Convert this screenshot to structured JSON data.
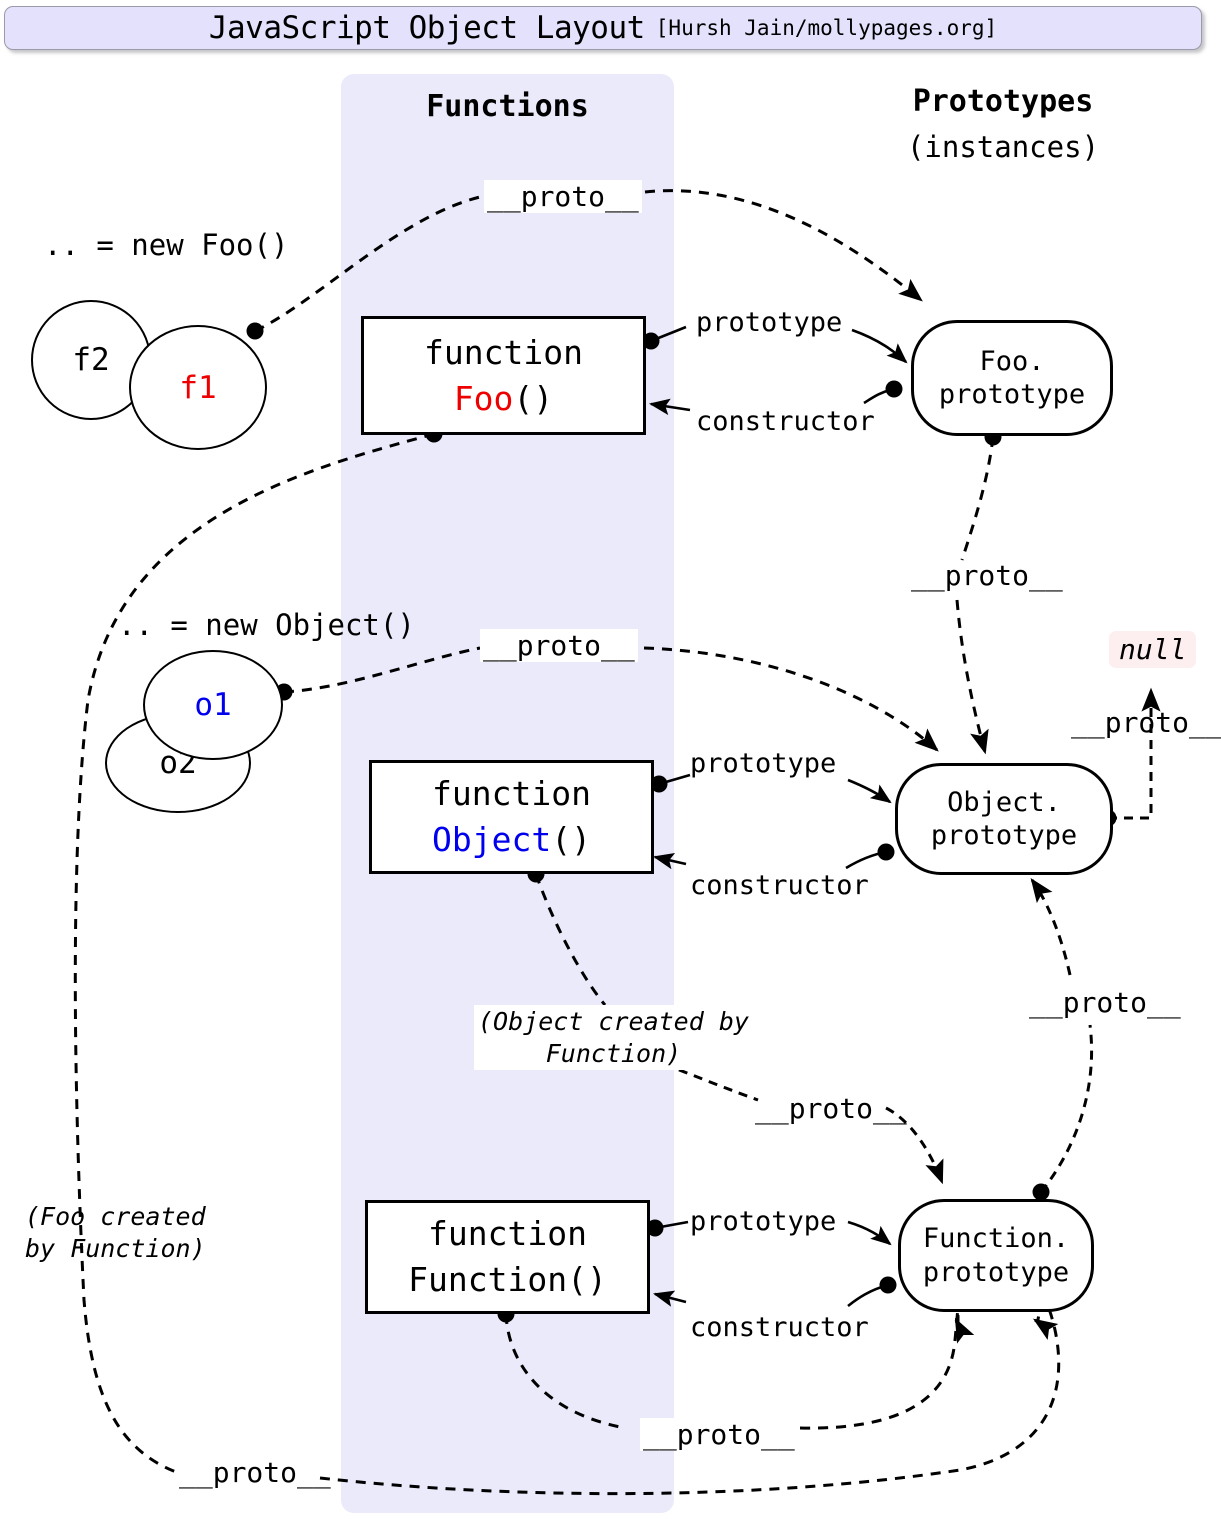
{
  "title": {
    "main": "JavaScript Object Layout",
    "credit": "[Hursh Jain/mollypages.org]"
  },
  "columns": {
    "functions_heading": "Functions",
    "prototypes_heading": "Prototypes",
    "prototypes_subheading": "(instances)"
  },
  "colors": {
    "band": "#eaeafb",
    "title_bar": "#e3e1fb",
    "foo_accent": "#ee0000",
    "object_accent": "#0000ee",
    "null_chip_bg": "#fdeef0"
  },
  "functions": [
    {
      "line1": "function",
      "name": "Foo",
      "parens": "()",
      "accent": "red"
    },
    {
      "line1": "function",
      "name": "Object",
      "parens": "()",
      "accent": "blue"
    },
    {
      "line1": "function",
      "name": "Function",
      "parens": "()",
      "accent": "black"
    }
  ],
  "prototypes": [
    {
      "line1": "Foo.",
      "line2": "prototype"
    },
    {
      "line1": "Object.",
      "line2": "prototype"
    },
    {
      "line1": "Function.",
      "line2": "prototype"
    }
  ],
  "instances": {
    "foo_caption": ".. = new Foo()",
    "foo_front": "f1",
    "foo_back": "f2",
    "object_caption": ".. = new Object()",
    "object_front": "o1",
    "object_back": "o2"
  },
  "edge_labels": {
    "proto": "__proto__",
    "prototype": "prototype",
    "constructor": "constructor"
  },
  "null_value": "null",
  "notes": {
    "object_created_line1": "(Object created by",
    "object_created_line2": "Function)",
    "foo_created_line1": "(Foo created",
    "foo_created_line2": "by Function)"
  }
}
